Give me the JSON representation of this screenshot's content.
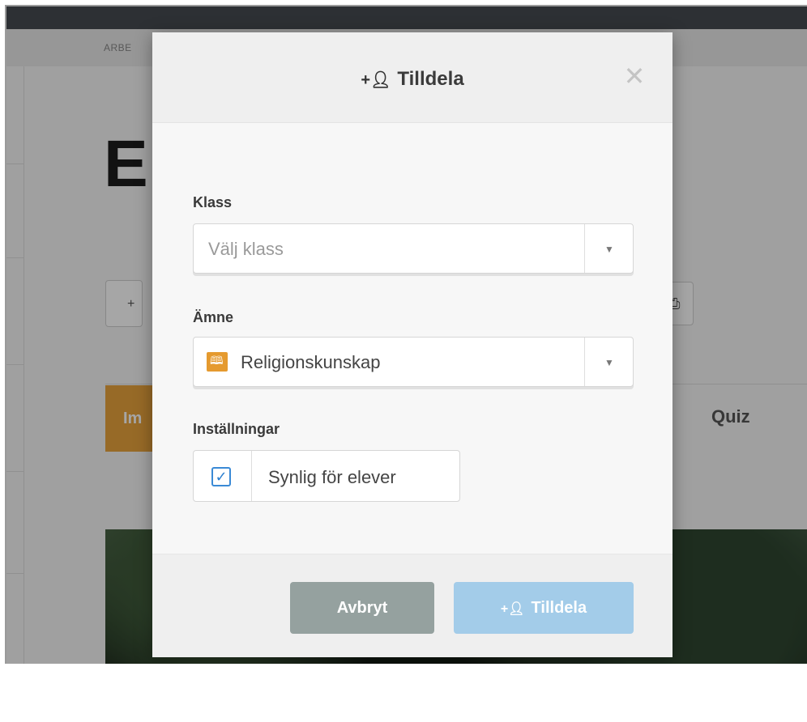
{
  "background": {
    "breadcrumb": "ARBE",
    "page_title_initial": "E",
    "active_tab_partial": "Im",
    "tab_quiz": "Quiz"
  },
  "modal": {
    "title": "Tilldela",
    "close_glyph": "✕",
    "class_field": {
      "label": "Klass",
      "placeholder": "Välj klass"
    },
    "subject_field": {
      "label": "Ämne",
      "selected": "Religionskunskap"
    },
    "settings": {
      "label": "Inställningar",
      "visible_checkbox": {
        "label": "Synlig för elever",
        "checked": true
      }
    },
    "buttons": {
      "cancel": "Avbryt",
      "assign": "Tilldela"
    }
  },
  "colors": {
    "accent_orange": "#e59a2f",
    "checkbox_blue": "#3a8ad6",
    "cancel_gray": "#95a19f",
    "assign_light_blue": "#a3cce9"
  },
  "icons": {
    "assign_icon": "user-plus-icon",
    "close_icon": "close-icon",
    "dropdown_icon": "chevron-down-icon",
    "subject_icon": "book-icon",
    "check_icon": "checkmark-icon",
    "print_icon": "print-icon"
  }
}
